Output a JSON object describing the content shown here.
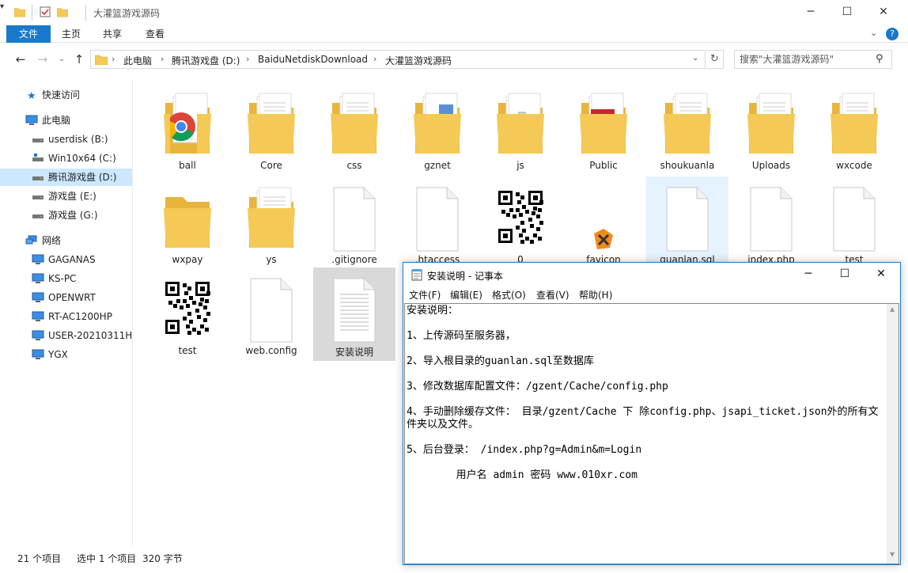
{
  "explorer": {
    "title": "大灌篮游戏源码",
    "ribbon_tabs": [
      "文件",
      "主页",
      "共享",
      "查看"
    ],
    "breadcrumb": [
      "此电脑",
      "腾讯游戏盘 (D:)",
      "BaiduNetdiskDownload",
      "大灌篮游戏源码"
    ],
    "search_placeholder": "搜索\"大灌篮游戏源码\"",
    "sidebar": {
      "quick_access": "快速访问",
      "this_pc": "此电脑",
      "drives": [
        "userdisk (B:)",
        "Win10x64 (C:)",
        "腾讯游戏盘 (D:)",
        "游戏盘 (E:)",
        "游戏盘 (G:)"
      ],
      "network": "网络",
      "computers": [
        "GAGANAS",
        "KS-PC",
        "OPENWRT",
        "RT-AC1200HP",
        "USER-20210311HI",
        "YGX"
      ]
    },
    "files": [
      {
        "name": "ball",
        "type": "folder-chrome"
      },
      {
        "name": "Core",
        "type": "folder-docs"
      },
      {
        "name": "css",
        "type": "folder-docs"
      },
      {
        "name": "gznet",
        "type": "folder-blue"
      },
      {
        "name": "js",
        "type": "folder-file"
      },
      {
        "name": "Public",
        "type": "folder-red"
      },
      {
        "name": "shoukuanla",
        "type": "folder-docs"
      },
      {
        "name": "Uploads",
        "type": "folder-docs"
      },
      {
        "name": "wxcode",
        "type": "folder-docs"
      },
      {
        "name": "wxpay",
        "type": "folder"
      },
      {
        "name": "ys",
        "type": "folder-docs"
      },
      {
        "name": ".gitignore",
        "type": "file"
      },
      {
        "name": ".htaccess",
        "type": "file"
      },
      {
        "name": "0",
        "type": "qr"
      },
      {
        "name": "favicon",
        "type": "favicon"
      },
      {
        "name": "guanlan.sql",
        "type": "file"
      },
      {
        "name": "index.php",
        "type": "file"
      },
      {
        "name": "test",
        "type": "file"
      },
      {
        "name": "test",
        "type": "qr"
      },
      {
        "name": "web.config",
        "type": "file"
      },
      {
        "name": "安装说明",
        "type": "textfile"
      }
    ],
    "status": {
      "count": "21 个项目",
      "selected": "选中 1 个项目",
      "size": "320 字节"
    }
  },
  "notepad": {
    "title": "安装说明 - 记事本",
    "menus": [
      "文件(F)",
      "编辑(E)",
      "格式(O)",
      "查看(V)",
      "帮助(H)"
    ],
    "content": "安装说明：\n\n1、上传源码至服务器，\n\n2、导入根目录的guanlan.sql至数据库\n\n3、修改数据库配置文件：/gzent/Cache/config.php\n\n4、手动删除缓存文件： 目录/gzent/Cache 下 除config.php、jsapi_ticket.json外的所有文件夹以及文件。\n\n5、后台登录： /index.php?g=Admin&m=Login\n\n        用户名 admin 密码 www.010xr.com"
  },
  "colors": {
    "accent": "#1979ca",
    "folder": "#f5c955",
    "folder_dark": "#e8b53c",
    "hover": "#e5f3ff",
    "selected": "#d9d9d9"
  }
}
